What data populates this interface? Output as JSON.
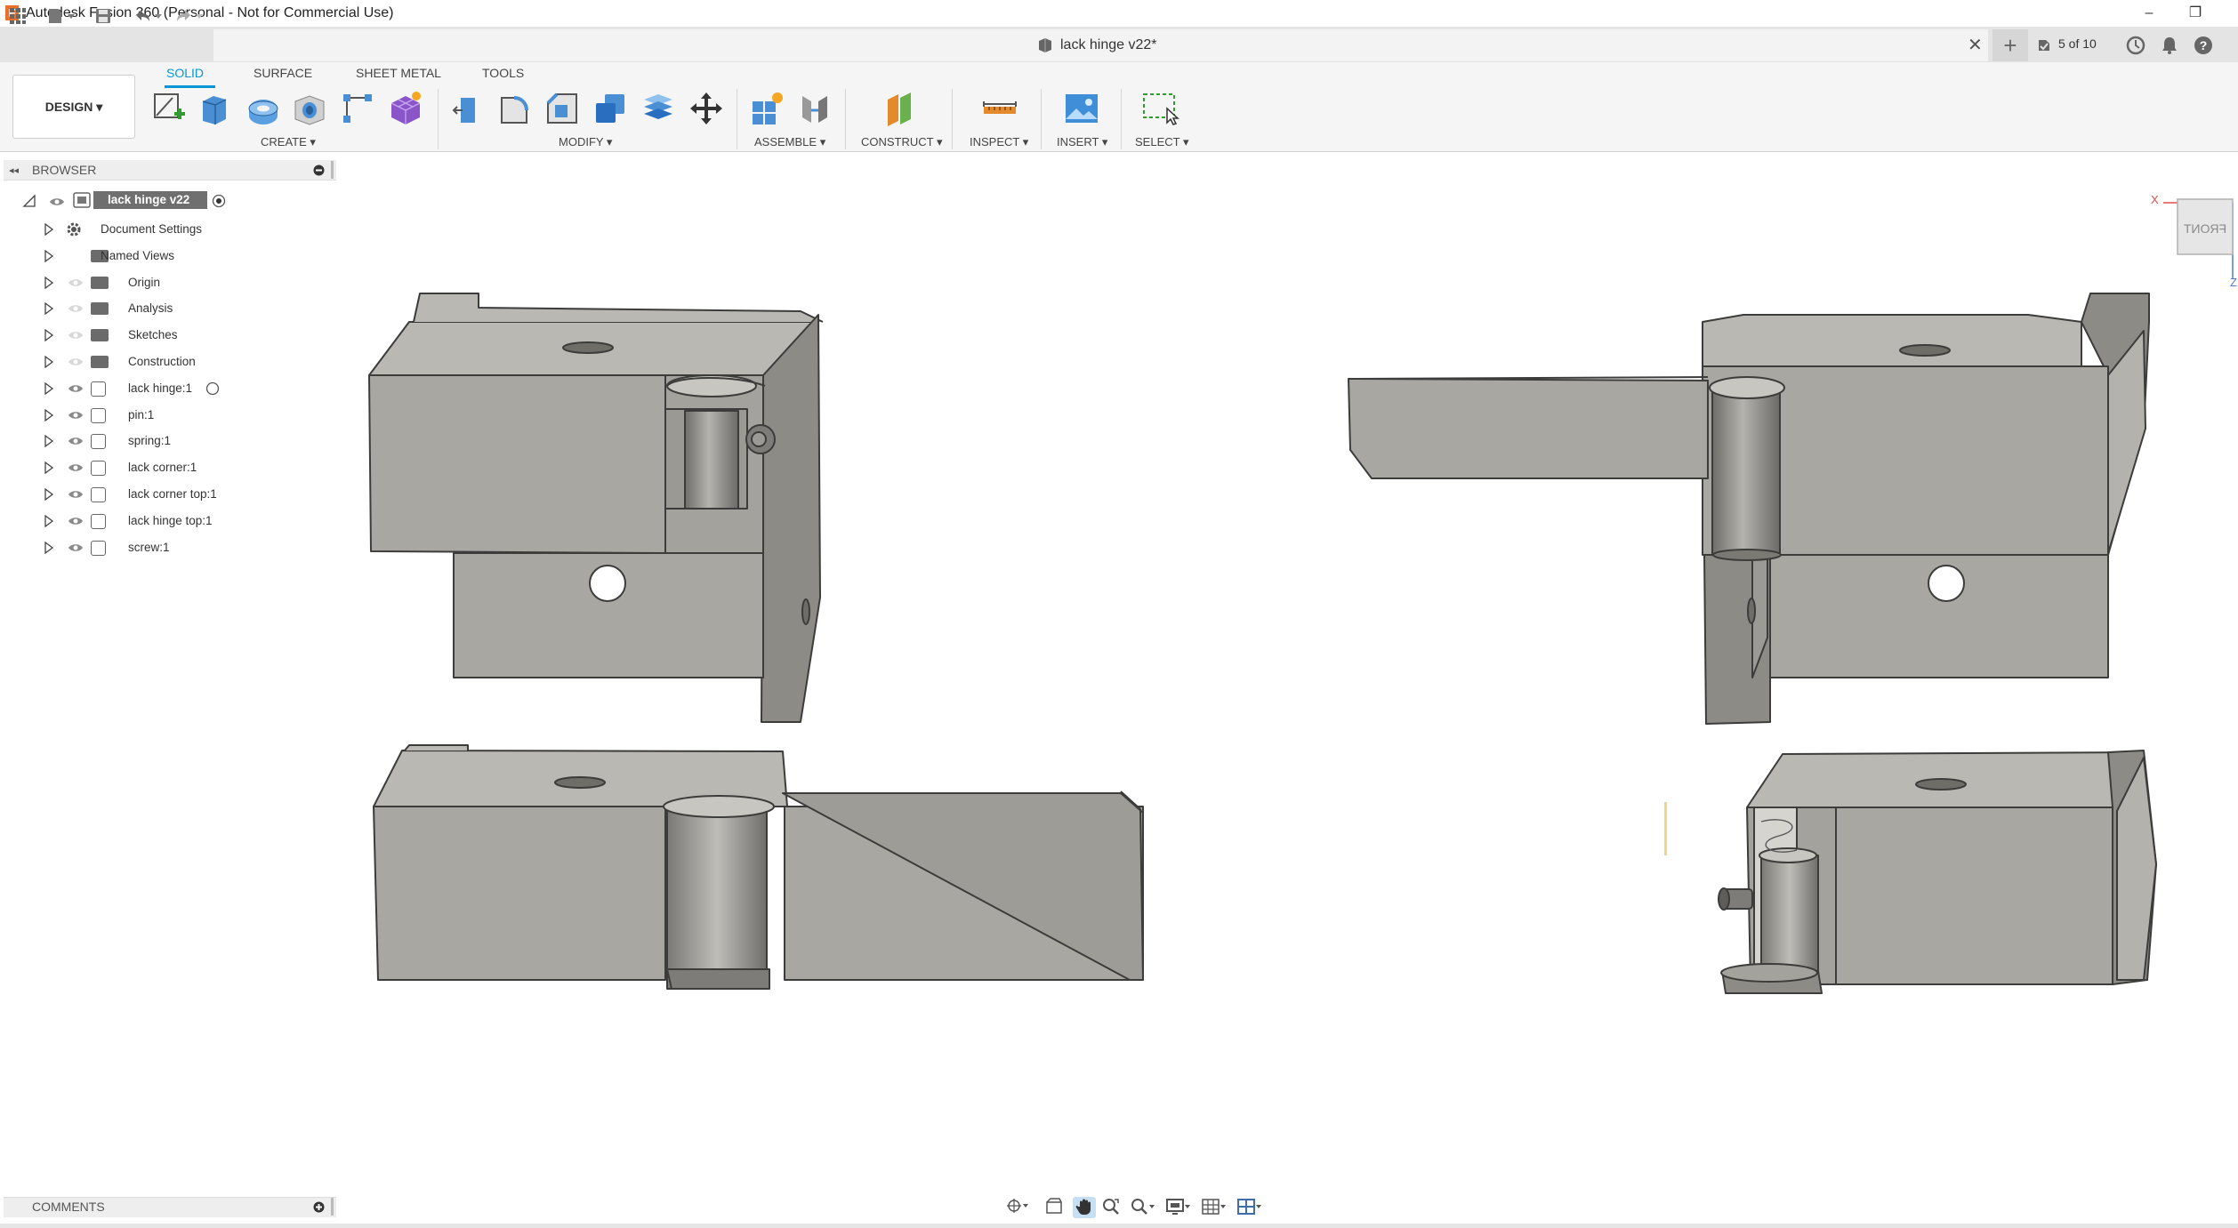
{
  "window": {
    "title": "Autodesk Fusion 360 (Personal - Not for Commercial Use)",
    "logo_letter": "F"
  },
  "tabs": {
    "document_title": "lack hinge v22*",
    "version_indicator": "5 of 10"
  },
  "workspace": {
    "label": "DESIGN ▾"
  },
  "toolbar_tabs": [
    "SOLID",
    "SURFACE",
    "SHEET METAL",
    "TOOLS"
  ],
  "tool_groups": {
    "create": "CREATE ▾",
    "modify": "MODIFY ▾",
    "assemble": "ASSEMBLE ▾",
    "construct": "CONSTRUCT ▾",
    "inspect": "INSPECT ▾",
    "insert": "INSERT ▾",
    "select": "SELECT ▾"
  },
  "browser": {
    "header": "BROWSER",
    "root": "lack hinge v22",
    "items": [
      {
        "label": "Document Settings",
        "icon": "gear-icon"
      },
      {
        "label": "Named Views",
        "icon": "folder-icon"
      },
      {
        "label": "Origin",
        "icon": "folder-icon"
      },
      {
        "label": "Analysis",
        "icon": "folder-icon"
      },
      {
        "label": "Sketches",
        "icon": "folder-icon"
      },
      {
        "label": "Construction",
        "icon": "folder-icon"
      },
      {
        "label": "lack hinge:1",
        "icon": "component-icon"
      },
      {
        "label": "pin:1",
        "icon": "component-icon"
      },
      {
        "label": "spring:1",
        "icon": "component-icon"
      },
      {
        "label": "lack corner:1",
        "icon": "component-icon"
      },
      {
        "label": "lack corner top:1",
        "icon": "component-icon"
      },
      {
        "label": "lack hinge top:1",
        "icon": "component-icon"
      },
      {
        "label": "screw:1",
        "icon": "component-icon"
      }
    ]
  },
  "comments": {
    "header": "COMMENTS"
  },
  "viewcube": {
    "face_label": "FRONT",
    "axis_x": "X",
    "axis_z": "Z"
  },
  "colors": {
    "accent": "#0696d7",
    "model_face": "#a8a7a2",
    "model_dark": "#8c8b86"
  }
}
